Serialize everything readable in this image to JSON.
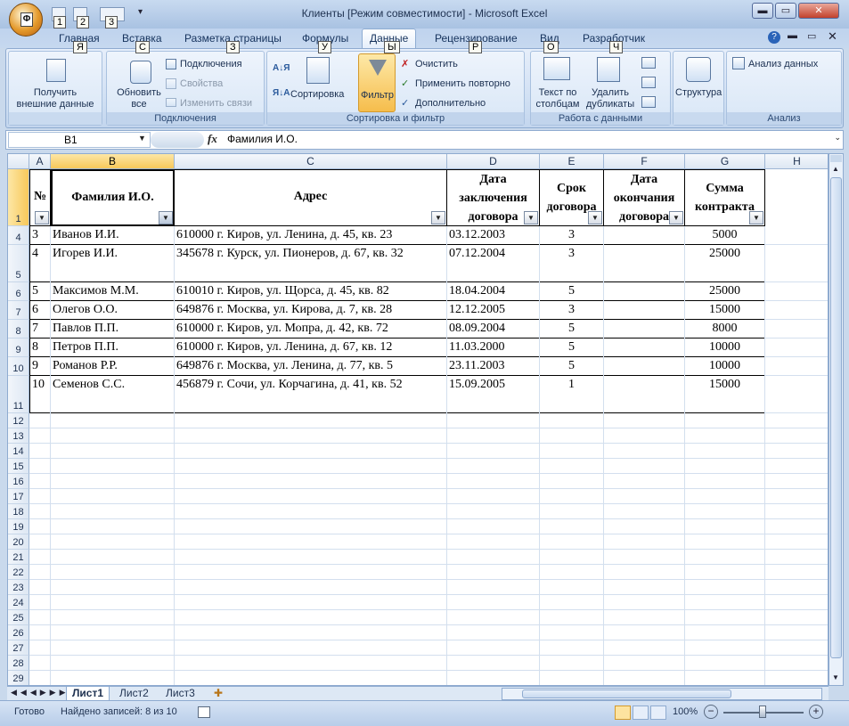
{
  "window": {
    "title": "Клиенты  [Режим совместимости] - Microsoft Excel",
    "office_key": "Ф",
    "qat_keys": [
      "1",
      "2",
      "3"
    ],
    "buttons": {
      "minimize": "▬",
      "maximize": "▭",
      "close": "✕"
    }
  },
  "tabs": [
    {
      "label": "Главная",
      "key": "Я"
    },
    {
      "label": "Вставка",
      "key": "С"
    },
    {
      "label": "Разметка страницы",
      "key": "З"
    },
    {
      "label": "Формулы",
      "key": "У"
    },
    {
      "label": "Данные",
      "key": "Ы"
    },
    {
      "label": "Рецензирование",
      "key": "Р"
    },
    {
      "label": "Вид",
      "key": "О"
    },
    {
      "label": "Разработчик",
      "key": "Ч"
    }
  ],
  "ribbon": {
    "get_external": "Получить\nвнешние данные",
    "groups": {
      "connections": "Подключения",
      "sort_filter": "Сортировка и фильтр",
      "data_tools": "Работа с данными",
      "analysis": "Анализ"
    },
    "refresh_all": "Обновить\nвсе",
    "connections": "Подключения",
    "properties": "Свойства",
    "edit_links": "Изменить связи",
    "sort": "Сортировка",
    "filter": "Фильтр",
    "clear": "Очистить",
    "reapply": "Применить повторно",
    "advanced": "Дополнительно",
    "text_to_cols": "Текст по\nстолбцам",
    "remove_dup": "Удалить\nдубликаты",
    "outline": "Структура",
    "data_analysis": "Анализ данных"
  },
  "formula": {
    "name_box": "B1",
    "fx": "fx",
    "value": "Фамилия И.О."
  },
  "columns": [
    "A",
    "B",
    "C",
    "D",
    "E",
    "F",
    "G",
    "H"
  ],
  "header_row": {
    "row": "1",
    "A": "№",
    "B": "Фамилия И.О.",
    "C": "Адрес",
    "D": "Дата\nзаключения\nдоговора",
    "E": "Срок\nдоговора",
    "F": "Дата\nокончания\nдоговора",
    "G": "Сумма\nконтракта"
  },
  "rows": [
    {
      "row": "4",
      "num": "3",
      "name": "Иванов И.И.",
      "addr": "610000 г. Киров, ул. Ленина, д. 45, кв. 23",
      "date": "03.12.2003",
      "term": "3",
      "end": "",
      "sum": "5000"
    },
    {
      "row": "5",
      "num": "4",
      "name": "Игорев И.И.",
      "addr": "345678 г. Курск, ул. Пионеров, д. 67, кв. 32",
      "date": "07.12.2004",
      "term": "3",
      "end": "",
      "sum": "25000"
    },
    {
      "row": "6",
      "num": "5",
      "name": "Максимов М.М.",
      "addr": "610010 г. Киров, ул. Щорса, д. 45, кв. 82",
      "date": "18.04.2004",
      "term": "5",
      "end": "",
      "sum": "25000"
    },
    {
      "row": "7",
      "num": "6",
      "name": "Олегов О.О.",
      "addr": "649876 г. Москва, ул. Кирова, д. 7, кв. 28",
      "date": "12.12.2005",
      "term": "3",
      "end": "",
      "sum": "15000"
    },
    {
      "row": "8",
      "num": "7",
      "name": "Павлов П.П.",
      "addr": "610000 г. Киров, ул. Мопра, д. 42, кв. 72",
      "date": "08.09.2004",
      "term": "5",
      "end": "",
      "sum": "8000"
    },
    {
      "row": "9",
      "num": "8",
      "name": "Петров П.П.",
      "addr": "610000 г. Киров, ул. Ленина, д. 67, кв. 12",
      "date": "11.03.2000",
      "term": "5",
      "end": "",
      "sum": "10000"
    },
    {
      "row": "10",
      "num": "9",
      "name": "Романов Р.Р.",
      "addr": "649876 г. Москва, ул. Ленина, д. 77, кв. 5",
      "date": "23.11.2003",
      "term": "5",
      "end": "",
      "sum": "10000"
    },
    {
      "row": "11",
      "num": "10",
      "name": "Семенов С.С.",
      "addr": "456879 г. Сочи, ул. Корчагина, д. 41, кв. 52",
      "date": "15.09.2005",
      "term": "1",
      "end": "",
      "sum": "15000"
    }
  ],
  "empty_rows": [
    "12",
    "13",
    "14",
    "15",
    "16",
    "17",
    "18",
    "19",
    "20",
    "21",
    "22",
    "23",
    "24",
    "25",
    "26",
    "27",
    "28",
    "29"
  ],
  "sheets": [
    "Лист1",
    "Лист2",
    "Лист3"
  ],
  "status": {
    "ready": "Готово",
    "found": "Найдено записей: 8 из 10",
    "zoom": "100%"
  }
}
